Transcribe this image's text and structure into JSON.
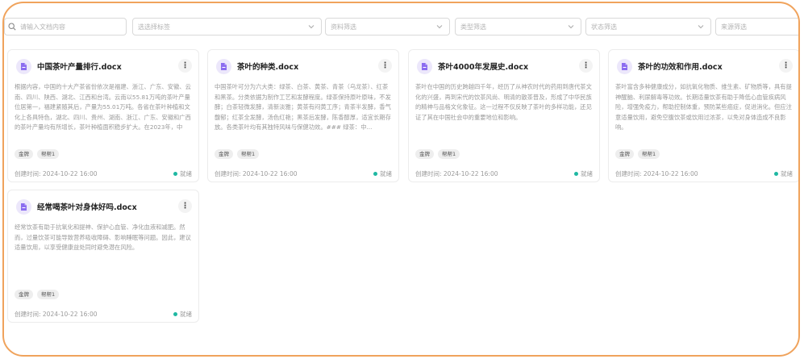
{
  "filters": {
    "search_placeholder": "请输入文档内容",
    "items": [
      {
        "placeholder": "选选择标签"
      },
      {
        "placeholder": "资料筛选"
      },
      {
        "placeholder": "类型筛选"
      },
      {
        "placeholder": "状态筛选"
      },
      {
        "placeholder": "来源筛选"
      }
    ]
  },
  "cards": [
    {
      "title": "中国茶叶产量排行.docx",
      "more": "⋮",
      "summary": "根据内容，中国的十大产茶省份依次是福建、浙江、广东、安徽、云南、四川、陕西、湖北、江西和台湾。云南以55.81万吨的茶叶产量位居第一，福建紧随其后，产量为55.01万吨。各省在茶叶种植和文化上各具特色，湖北、四川、贵州、湖南、浙江、广东、安徽和广西的茶叶产量均有所增长，茶叶种植面积稳步扩大。在2023年，中国...",
      "tags": [
        "金牌",
        "帮帮1"
      ],
      "time": "创建时间: 2024-10-22 16:00",
      "status": "就绪"
    },
    {
      "title": "茶叶的种类.docx",
      "more": "⋮",
      "summary": "中国茶叶可分为六大类：绿茶、白茶、黄茶、青茶（乌龙茶）、红茶和黑茶。分类依据为制作工艺和发酵程度。绿茶保持原叶原味，不发酵；白茶轻微发酵，清新淡雅；黄茶有闷黄工序；青茶半发酵，香气馥郁；红茶全发酵，汤色红艳；黑茶后发酵，陈香醇厚，适宜长期存放。各类茶叶均有其独特风味与保健功效。### 绿茶：中...",
      "tags": [
        "金牌",
        "帮帮1"
      ],
      "time": "创建时间: 2024-10-22 16:00",
      "status": "就绪"
    },
    {
      "title": "茶叶4000年发展史.docx",
      "more": "⋮",
      "summary": "茶叶在中国的历史跨越四千年，经历了从神农时代的药用到唐代茶文化的兴盛，再到宋代的饮茶风尚、明清的散茶普及，形成了中华民族的精神与品格文化象征。这一过程不仅反映了茶叶的多样功能，还见证了其在中国社会中的重要地位和影响。",
      "tags": [
        "金牌",
        "帮帮1"
      ],
      "time": "创建时间: 2024-10-22 16:00",
      "status": "就绪"
    },
    {
      "title": "茶叶的功效和作用.docx",
      "more": "⋮",
      "summary": "茶叶富含多种健康成分，如抗氧化物质、维生素、矿物质等，具有提神醒脑、利尿解毒等功效。长期适量饮茶有助于降低心血管疾病风险，增强免疫力，帮助控制体重，预防某些癌症，促进消化。但应注意适量饮用，避免空腹饮茶或饮用过浓茶，以免对身体造成不良影响。",
      "tags": [
        "金牌",
        "帮帮1"
      ],
      "time": "创建时间: 2024-10-22 16:00",
      "status": "就绪"
    },
    {
      "title": "经常喝茶叶对身体好吗.docx",
      "more": "⋮",
      "summary": "经常饮茶有助于抗氧化和提神、保护心血管、净化血液和减肥。然而，过量饮茶可能导致营养吸收障碍、影响睡眠等问题。因此，建议适量饮用，以享受健康益处同时避免潜在风险。",
      "tags": [
        "金牌",
        "帮帮1"
      ],
      "time": "创建时间: 2024-10-22 16:00",
      "status": "就绪"
    }
  ]
}
